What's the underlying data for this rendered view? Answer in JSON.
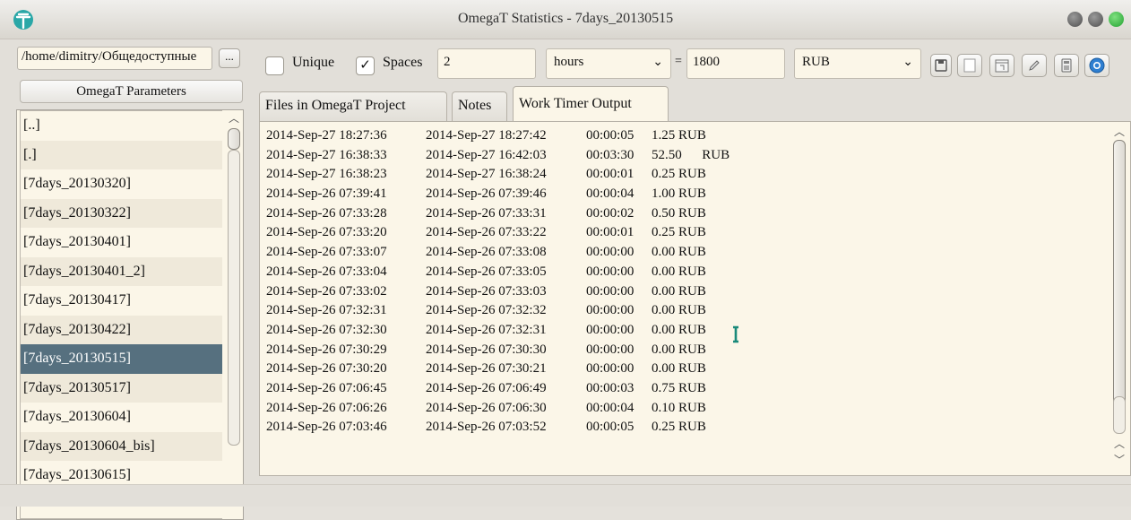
{
  "window": {
    "title": "OmegaT Statistics  -  7days_20130515"
  },
  "left_panel": {
    "path_value": "/home/dimitry/Общедоступные",
    "browse_label": "...",
    "params_label": "OmegaT Parameters",
    "dir_items": [
      "[..]",
      "[.]",
      "[7days_20130320]",
      "[7days_20130322]",
      "[7days_20130401]",
      "[7days_20130401_2]",
      "[7days_20130417]",
      "[7days_20130422]",
      "[7days_20130515]",
      "[7days_20130517]",
      "[7days_20130604]",
      "[7days_20130604_bis]",
      "[7days_20130615]"
    ],
    "selected_item": "[7days_20130515]"
  },
  "toolbar": {
    "unique_label": "Unique",
    "unique_checked": false,
    "spaces_label": "Spaces",
    "spaces_checked": true,
    "spaces_value": "2",
    "unit_value": "hours",
    "equals": "=",
    "rate_value": "1800",
    "currency_value": "RUB",
    "check_mark": "✓",
    "combo_arrow": "⌄"
  },
  "tabs": [
    {
      "label": "Files in OmegaT Project",
      "active": false
    },
    {
      "label": "Notes",
      "active": false
    },
    {
      "label": "Work Timer Output",
      "active": true
    }
  ],
  "timer_output": [
    [
      "2014-Sep-27 18:27:36",
      "2014-Sep-27 18:27:42",
      "00:00:05",
      "1.25 RUB"
    ],
    [
      "2014-Sep-27 16:38:33",
      "2014-Sep-27 16:42:03",
      "00:03:30",
      "52.50      RUB"
    ],
    [
      "2014-Sep-27 16:38:23",
      "2014-Sep-27 16:38:24",
      "00:00:01",
      "0.25 RUB"
    ],
    [
      "2014-Sep-26 07:39:41",
      "2014-Sep-26 07:39:46",
      "00:00:04",
      "1.00 RUB"
    ],
    [
      "2014-Sep-26 07:33:28",
      "2014-Sep-26 07:33:31",
      "00:00:02",
      "0.50 RUB"
    ],
    [
      "2014-Sep-26 07:33:20",
      "2014-Sep-26 07:33:22",
      "00:00:01",
      "0.25 RUB"
    ],
    [
      "2014-Sep-26 07:33:07",
      "2014-Sep-26 07:33:08",
      "00:00:00",
      "0.00 RUB"
    ],
    [
      "2014-Sep-26 07:33:04",
      "2014-Sep-26 07:33:05",
      "00:00:00",
      "0.00 RUB"
    ],
    [
      "2014-Sep-26 07:33:02",
      "2014-Sep-26 07:33:03",
      "00:00:00",
      "0.00 RUB"
    ],
    [
      "2014-Sep-26 07:32:31",
      "2014-Sep-26 07:32:32",
      "00:00:00",
      "0.00 RUB"
    ],
    [
      "2014-Sep-26 07:32:30",
      "2014-Sep-26 07:32:31",
      "00:00:00",
      "0.00 RUB"
    ],
    [
      "2014-Sep-26 07:30:29",
      "2014-Sep-26 07:30:30",
      "00:00:00",
      "0.00 RUB"
    ],
    [
      "2014-Sep-26 07:30:20",
      "2014-Sep-26 07:30:21",
      "00:00:00",
      "0.00 RUB"
    ],
    [
      "2014-Sep-26 07:06:45",
      "2014-Sep-26 07:06:49",
      "00:00:03",
      "0.75 RUB"
    ],
    [
      "2014-Sep-26 07:06:26",
      "2014-Sep-26 07:06:30",
      "00:00:04",
      "0.10 RUB"
    ],
    [
      "2014-Sep-26 07:03:46",
      "2014-Sep-26 07:03:52",
      "00:00:05",
      "0.25 RUB"
    ]
  ],
  "icons": {
    "app": "omegat-logo-icon",
    "save": "save-icon",
    "blank": "blank-page-icon",
    "calendar": "calendar-icon",
    "edit": "pencil-icon",
    "calculator": "calculator-icon",
    "help": "help-icon",
    "scroll_up": "chevron-up-icon",
    "scroll_down": "chevron-down-icon",
    "text_cursor": "text-cursor-icon"
  },
  "colors": {
    "selection": "#56707f",
    "panel_bg": "#fbf6e8",
    "window_bg": "#e2dfd9",
    "close_button": "#3fbf4f",
    "accent_blue": "#2f7fd1"
  }
}
